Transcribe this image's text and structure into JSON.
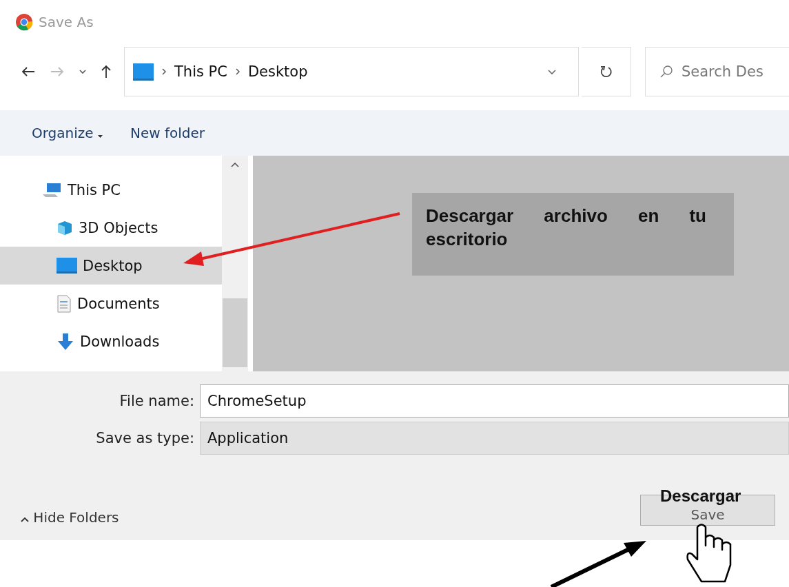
{
  "window": {
    "title": "Save As"
  },
  "address_bar": {
    "path": [
      "This PC",
      "Desktop"
    ]
  },
  "search": {
    "placeholder": "Search Des"
  },
  "toolbar": {
    "organize": "Organize",
    "new_folder": "New folder"
  },
  "sidebar": {
    "items": [
      {
        "label": "This PC",
        "kind": "pc",
        "selected": false
      },
      {
        "label": "3D Objects",
        "kind": "cube",
        "selected": false
      },
      {
        "label": "Desktop",
        "kind": "desktop",
        "selected": true
      },
      {
        "label": "Documents",
        "kind": "document",
        "selected": false
      },
      {
        "label": "Downloads",
        "kind": "download",
        "selected": false
      }
    ]
  },
  "form": {
    "file_name_label": "File name:",
    "file_name": "ChromeSetup",
    "type_label": "Save as type:",
    "type": "Application"
  },
  "hide_folders": "Hide Folders",
  "save_button": "Save",
  "annotations": {
    "callout": "Descargar archivo en tu escritorio",
    "button_label": "Descargar"
  }
}
